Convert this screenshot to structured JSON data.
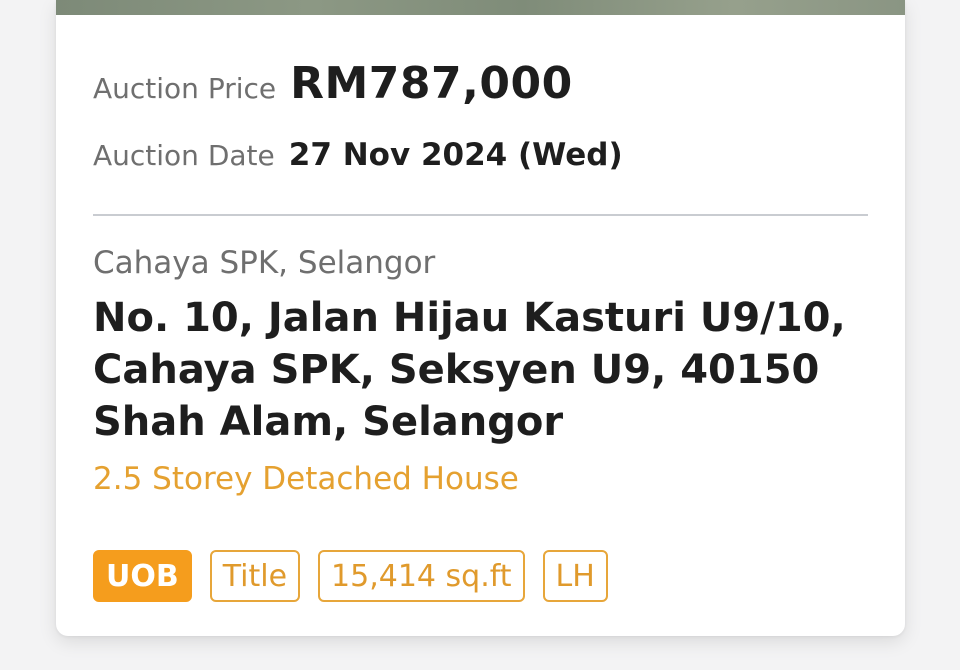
{
  "listing": {
    "auction_price_label": "Auction Price",
    "auction_price": "RM787,000",
    "auction_date_label": "Auction Date",
    "auction_date": "27 Nov 2024 (Wed)",
    "area": "Cahaya SPK, Selangor",
    "address": "No. 10, Jalan Hijau Kasturi U9/10, Cahaya SPK, Seksyen U9, 40150 Shah Alam, Selangor",
    "property_type": "2.5 Storey Detached House",
    "tags": {
      "bank": "UOB",
      "title": "Title",
      "size": "15,414 sq.ft",
      "tenure": "LH"
    }
  },
  "colors": {
    "accent": "#f59d1d",
    "property_type": "#e5a130"
  }
}
